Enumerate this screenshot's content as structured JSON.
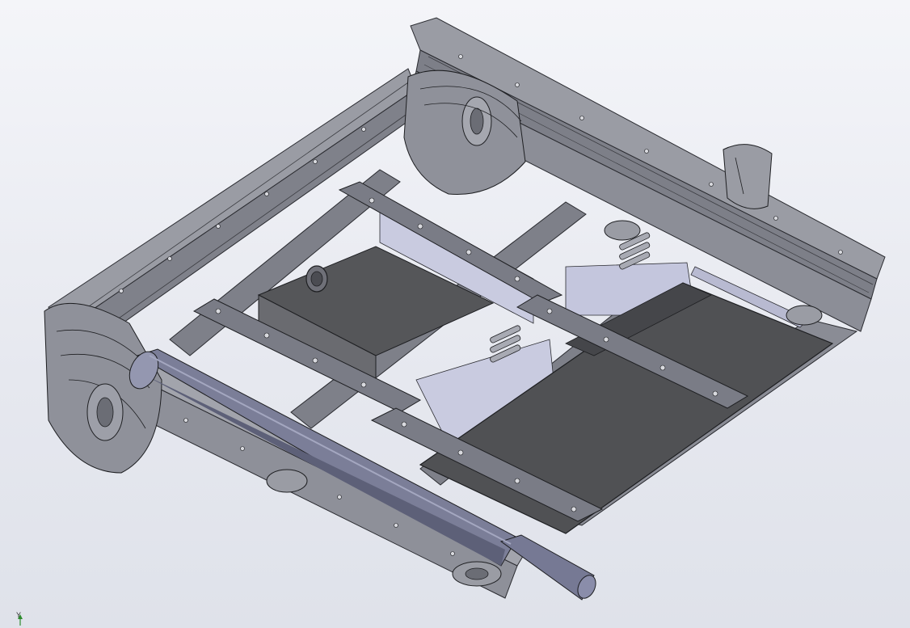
{
  "viewport": {
    "background_top": "#f4f5f9",
    "background_bottom": "#dfe2ea",
    "model_color": "#8a8c95",
    "model_dark": "#4a4b52",
    "plate_color": "#555659",
    "tube_color": "#7c7f98"
  },
  "triad": {
    "axis_label": "Y",
    "axis_color": "#2e8b2e"
  }
}
